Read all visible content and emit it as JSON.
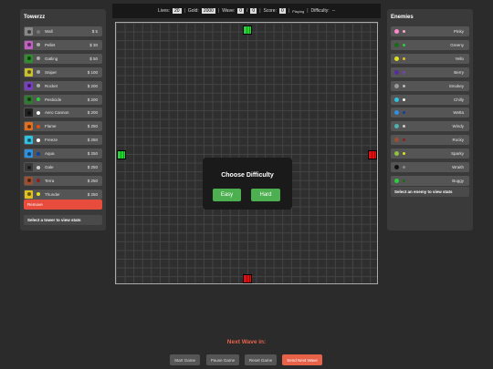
{
  "towers_panel": {
    "title": "Towerzz",
    "items": [
      {
        "name": "Wall",
        "price": "$ 5",
        "color": "#888888",
        "dot": "#777777"
      },
      {
        "name": "Pellet",
        "price": "$ 30",
        "color": "#c060c0",
        "dot": "#aaaaaa"
      },
      {
        "name": "Gatling",
        "price": "$ 50",
        "color": "#2e8b2e",
        "dot": "#aaaaaa"
      },
      {
        "name": "Sniper",
        "price": "$ 100",
        "color": "#c8c030",
        "dot": "#aaaaaa"
      },
      {
        "name": "Rocket",
        "price": "$ 200",
        "color": "#7a3fc0",
        "dot": "#aaaaaa"
      },
      {
        "name": "Pesticide",
        "price": "$ 200",
        "color": "#2e7a2e",
        "dot": "#2ecc40"
      },
      {
        "name": "Aero Cannon",
        "price": "$ 200",
        "color": "#222222",
        "dot": "#ffffff"
      },
      {
        "name": "Flame",
        "price": "$ 250",
        "color": "#e07020",
        "dot": "#e05010"
      },
      {
        "name": "Freeze",
        "price": "$ 250",
        "color": "#30c0e0",
        "dot": "#ffffff"
      },
      {
        "name": "Aqua",
        "price": "$ 250",
        "color": "#3090e0",
        "dot": "#1040a0"
      },
      {
        "name": "Gale",
        "price": "$ 250",
        "color": "#3a3a3a",
        "dot": "#cccccc"
      },
      {
        "name": "Terra",
        "price": "$ 250",
        "color": "#9a5030",
        "dot": "#8a2020"
      },
      {
        "name": "Thunder",
        "price": "$ 250",
        "color": "#e0c020",
        "dot": "#e0e020"
      }
    ],
    "remove_label": "Remove",
    "hint": "Select a tower to view stats"
  },
  "enemies_panel": {
    "title": "Enemies",
    "items": [
      {
        "name": "Pinky",
        "color": "#ff88cc",
        "dot": "#ffaacc"
      },
      {
        "name": "Greeny",
        "color": "#1a6a1a",
        "dot": "#2ecc40"
      },
      {
        "name": "Yello",
        "color": "#e0e020",
        "dot": "#e0c020"
      },
      {
        "name": "Berry",
        "color": "#5a2aa0",
        "dot": "#7a3fc0"
      },
      {
        "name": "Smokey",
        "color": "#999999",
        "dot": "#bbbbbb"
      },
      {
        "name": "Chilly",
        "color": "#30c0e0",
        "dot": "#ffffff"
      },
      {
        "name": "Wetta",
        "color": "#3090e0",
        "dot": "#1040a0"
      },
      {
        "name": "Windy",
        "color": "#50b0b0",
        "dot": "#cccccc"
      },
      {
        "name": "Rocky",
        "color": "#9a5030",
        "dot": "#8a2020"
      },
      {
        "name": "Sparky",
        "color": "#90c040",
        "dot": "#e0e020"
      },
      {
        "name": "Wraith",
        "color": "#111111",
        "dot": "#888888"
      },
      {
        "name": "Buggy",
        "color": "#2ecc40",
        "dot": "#1a6a1a"
      }
    ],
    "hint": "Select an enemy to view stats"
  },
  "status": {
    "lives_label": "Lives:",
    "lives": "20",
    "gold_label": "Gold:",
    "gold": "2000",
    "wave_label": "Wave:",
    "wave": "0",
    "wave_sep": "/",
    "wave_total": "0",
    "score_label": "Score:",
    "score": "0",
    "state": "Playing",
    "difficulty_label": "Difficulty:",
    "difficulty": "--"
  },
  "modal": {
    "title": "Choose Difficulty",
    "easy_label": "Easy",
    "hard_label": "Hard"
  },
  "next_wave_label": "Next Wave in:",
  "controls": {
    "start": "Start Game",
    "pause": "Pause Game",
    "reset": "Reset Game",
    "send": "Send Next Wave"
  },
  "colors": {
    "accent_red": "#e74c3c",
    "button_green": "#4caf50",
    "portal_green": "#2ecc40",
    "portal_red": "#e01010"
  }
}
